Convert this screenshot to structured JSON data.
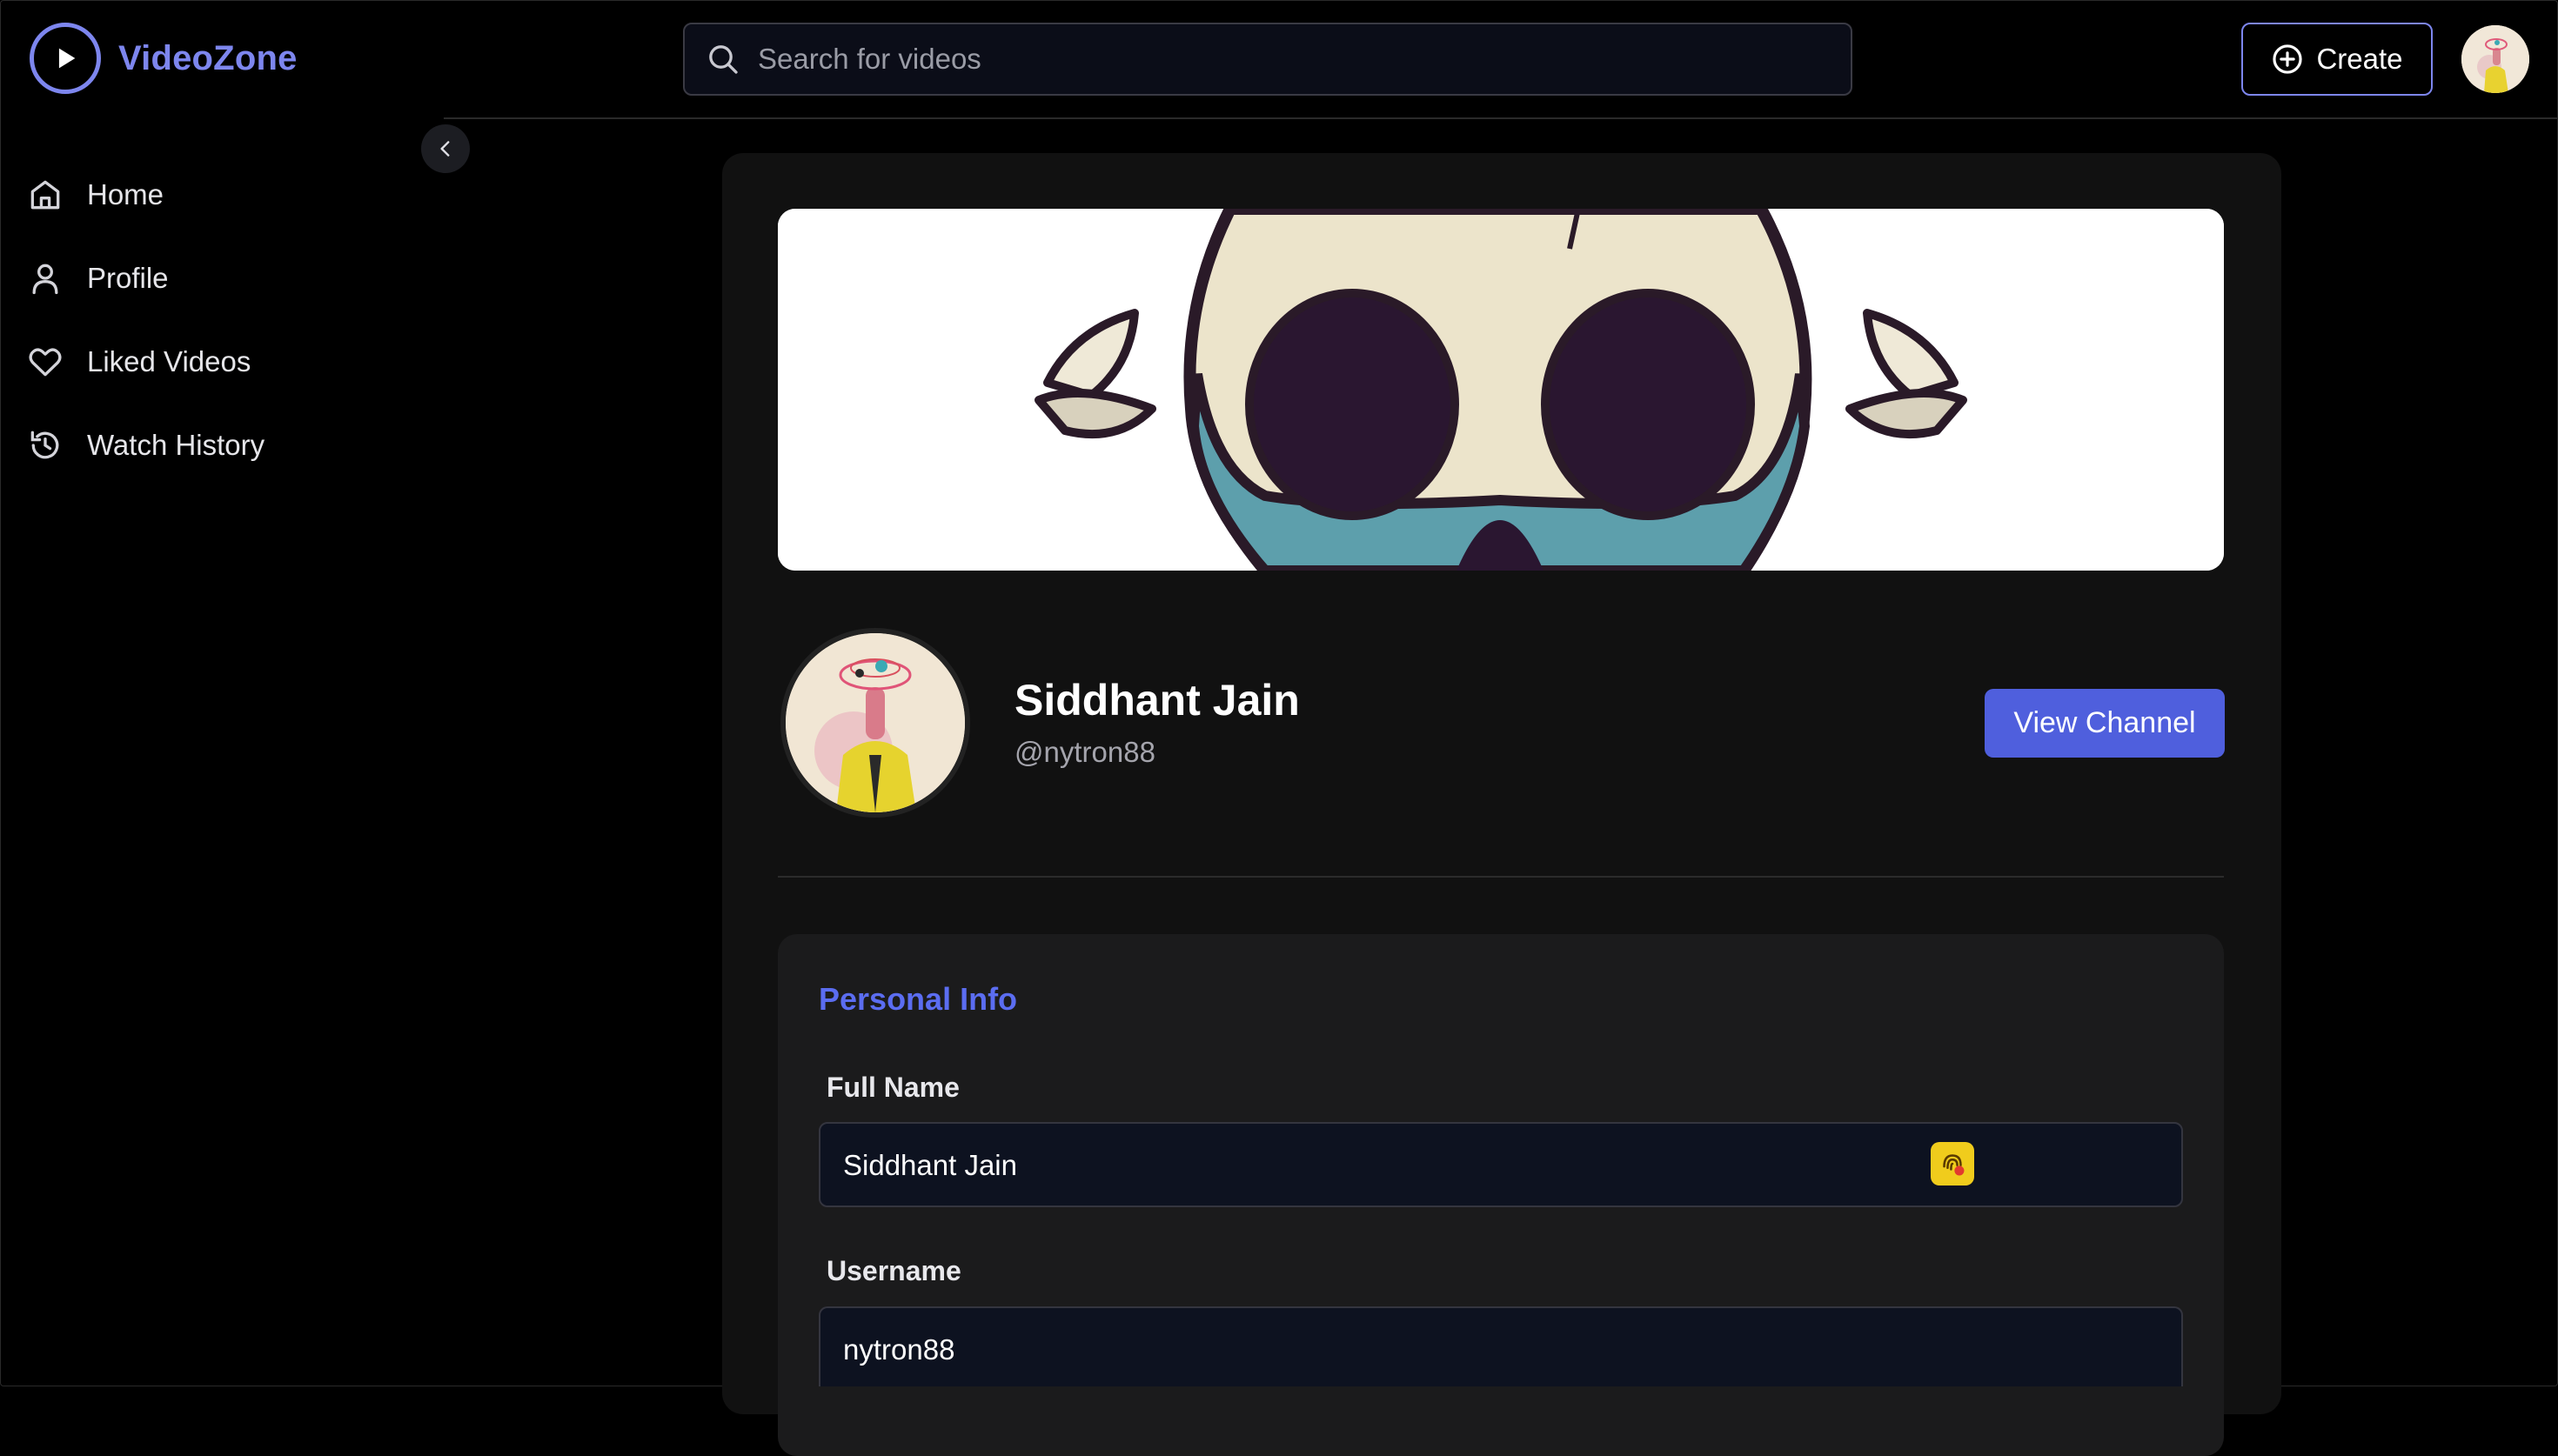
{
  "app": {
    "name": "VideoZone",
    "accent_color": "#7d86ee",
    "primary_button_color": "#4f5fdd"
  },
  "header": {
    "search": {
      "placeholder": "Search for videos"
    },
    "create_label": "Create"
  },
  "sidebar": {
    "items": [
      {
        "label": "Home",
        "icon": "home-icon"
      },
      {
        "label": "Profile",
        "icon": "user-icon"
      },
      {
        "label": "Liked Videos",
        "icon": "heart-icon"
      },
      {
        "label": "Watch History",
        "icon": "history-icon"
      }
    ]
  },
  "profile": {
    "name": "Siddhant Jain",
    "handle": "@nytron88",
    "view_channel_label": "View Channel"
  },
  "personal_info": {
    "title": "Personal Info",
    "full_name_label": "Full Name",
    "full_name_value": "Siddhant Jain",
    "username_label": "Username",
    "username_value": "nytron88"
  }
}
